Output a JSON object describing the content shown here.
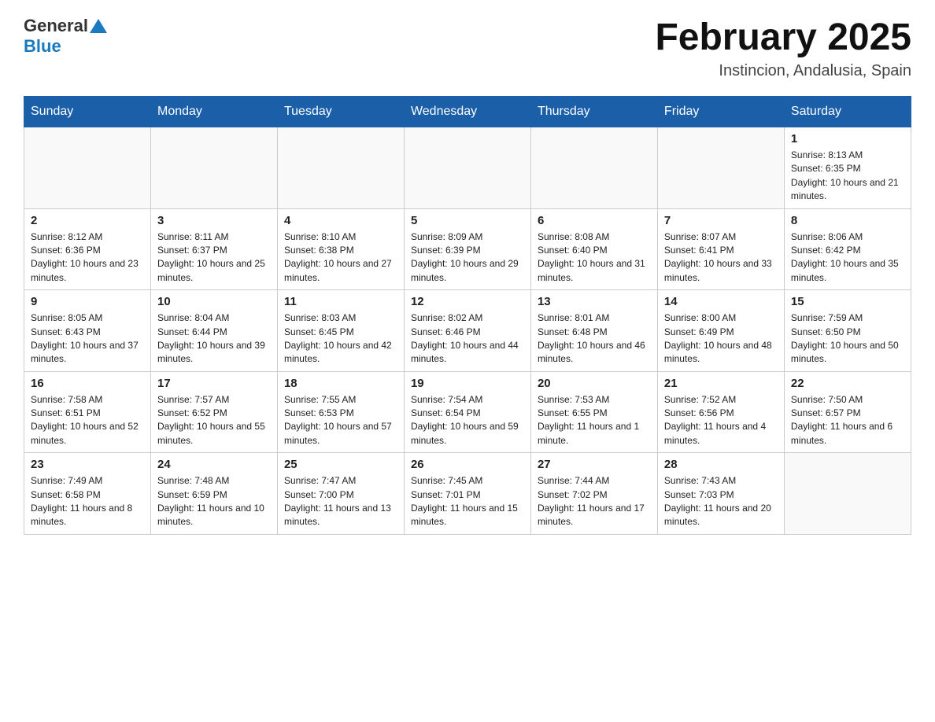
{
  "header": {
    "logo_general": "General",
    "logo_blue": "Blue",
    "month_title": "February 2025",
    "subtitle": "Instincion, Andalusia, Spain"
  },
  "days_of_week": [
    "Sunday",
    "Monday",
    "Tuesday",
    "Wednesday",
    "Thursday",
    "Friday",
    "Saturday"
  ],
  "weeks": [
    [
      {
        "day": "",
        "info": ""
      },
      {
        "day": "",
        "info": ""
      },
      {
        "day": "",
        "info": ""
      },
      {
        "day": "",
        "info": ""
      },
      {
        "day": "",
        "info": ""
      },
      {
        "day": "",
        "info": ""
      },
      {
        "day": "1",
        "info": "Sunrise: 8:13 AM\nSunset: 6:35 PM\nDaylight: 10 hours and 21 minutes."
      }
    ],
    [
      {
        "day": "2",
        "info": "Sunrise: 8:12 AM\nSunset: 6:36 PM\nDaylight: 10 hours and 23 minutes."
      },
      {
        "day": "3",
        "info": "Sunrise: 8:11 AM\nSunset: 6:37 PM\nDaylight: 10 hours and 25 minutes."
      },
      {
        "day": "4",
        "info": "Sunrise: 8:10 AM\nSunset: 6:38 PM\nDaylight: 10 hours and 27 minutes."
      },
      {
        "day": "5",
        "info": "Sunrise: 8:09 AM\nSunset: 6:39 PM\nDaylight: 10 hours and 29 minutes."
      },
      {
        "day": "6",
        "info": "Sunrise: 8:08 AM\nSunset: 6:40 PM\nDaylight: 10 hours and 31 minutes."
      },
      {
        "day": "7",
        "info": "Sunrise: 8:07 AM\nSunset: 6:41 PM\nDaylight: 10 hours and 33 minutes."
      },
      {
        "day": "8",
        "info": "Sunrise: 8:06 AM\nSunset: 6:42 PM\nDaylight: 10 hours and 35 minutes."
      }
    ],
    [
      {
        "day": "9",
        "info": "Sunrise: 8:05 AM\nSunset: 6:43 PM\nDaylight: 10 hours and 37 minutes."
      },
      {
        "day": "10",
        "info": "Sunrise: 8:04 AM\nSunset: 6:44 PM\nDaylight: 10 hours and 39 minutes."
      },
      {
        "day": "11",
        "info": "Sunrise: 8:03 AM\nSunset: 6:45 PM\nDaylight: 10 hours and 42 minutes."
      },
      {
        "day": "12",
        "info": "Sunrise: 8:02 AM\nSunset: 6:46 PM\nDaylight: 10 hours and 44 minutes."
      },
      {
        "day": "13",
        "info": "Sunrise: 8:01 AM\nSunset: 6:48 PM\nDaylight: 10 hours and 46 minutes."
      },
      {
        "day": "14",
        "info": "Sunrise: 8:00 AM\nSunset: 6:49 PM\nDaylight: 10 hours and 48 minutes."
      },
      {
        "day": "15",
        "info": "Sunrise: 7:59 AM\nSunset: 6:50 PM\nDaylight: 10 hours and 50 minutes."
      }
    ],
    [
      {
        "day": "16",
        "info": "Sunrise: 7:58 AM\nSunset: 6:51 PM\nDaylight: 10 hours and 52 minutes."
      },
      {
        "day": "17",
        "info": "Sunrise: 7:57 AM\nSunset: 6:52 PM\nDaylight: 10 hours and 55 minutes."
      },
      {
        "day": "18",
        "info": "Sunrise: 7:55 AM\nSunset: 6:53 PM\nDaylight: 10 hours and 57 minutes."
      },
      {
        "day": "19",
        "info": "Sunrise: 7:54 AM\nSunset: 6:54 PM\nDaylight: 10 hours and 59 minutes."
      },
      {
        "day": "20",
        "info": "Sunrise: 7:53 AM\nSunset: 6:55 PM\nDaylight: 11 hours and 1 minute."
      },
      {
        "day": "21",
        "info": "Sunrise: 7:52 AM\nSunset: 6:56 PM\nDaylight: 11 hours and 4 minutes."
      },
      {
        "day": "22",
        "info": "Sunrise: 7:50 AM\nSunset: 6:57 PM\nDaylight: 11 hours and 6 minutes."
      }
    ],
    [
      {
        "day": "23",
        "info": "Sunrise: 7:49 AM\nSunset: 6:58 PM\nDaylight: 11 hours and 8 minutes."
      },
      {
        "day": "24",
        "info": "Sunrise: 7:48 AM\nSunset: 6:59 PM\nDaylight: 11 hours and 10 minutes."
      },
      {
        "day": "25",
        "info": "Sunrise: 7:47 AM\nSunset: 7:00 PM\nDaylight: 11 hours and 13 minutes."
      },
      {
        "day": "26",
        "info": "Sunrise: 7:45 AM\nSunset: 7:01 PM\nDaylight: 11 hours and 15 minutes."
      },
      {
        "day": "27",
        "info": "Sunrise: 7:44 AM\nSunset: 7:02 PM\nDaylight: 11 hours and 17 minutes."
      },
      {
        "day": "28",
        "info": "Sunrise: 7:43 AM\nSunset: 7:03 PM\nDaylight: 11 hours and 20 minutes."
      },
      {
        "day": "",
        "info": ""
      }
    ]
  ]
}
